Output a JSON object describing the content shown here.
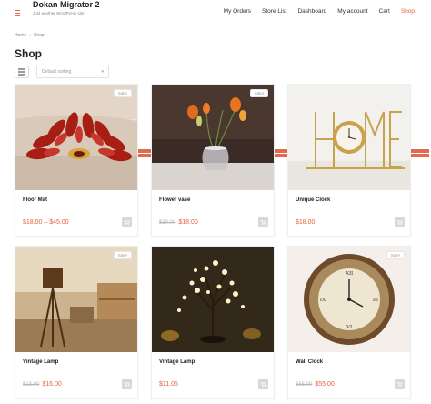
{
  "header": {
    "site_title": "Dokan Migrator 2",
    "tagline": "Just another WordPress site",
    "menu_icon": "hamburger-icon",
    "nav": [
      {
        "label": "My Orders",
        "active": false
      },
      {
        "label": "Store List",
        "active": false
      },
      {
        "label": "Dashboard",
        "active": false
      },
      {
        "label": "My account",
        "active": false
      },
      {
        "label": "Cart",
        "active": false
      },
      {
        "label": "Shop",
        "active": true
      }
    ]
  },
  "breadcrumb": {
    "home": "Home",
    "sep": "›",
    "current": "Shop"
  },
  "page": {
    "title": "Shop"
  },
  "toolbar": {
    "sort_value": "Default sorting",
    "view": "grid"
  },
  "colors": {
    "accent": "#e8613c",
    "muted": "#b5b5b5"
  },
  "products": [
    {
      "name": "Floor Mat",
      "sale_badge": "Sale!",
      "price_old": "",
      "price": "$18.00 – $45.00"
    },
    {
      "name": "Flower vase",
      "sale_badge": "Sale!",
      "price_old": "$30.00",
      "price": "$18.00"
    },
    {
      "name": "Unique Clock",
      "sale_badge": "",
      "price_old": "",
      "price": "$18.00"
    },
    {
      "name": "Vintage Lamp",
      "sale_badge": "Sale!",
      "price_old": "$18.00",
      "price": "$16.00"
    },
    {
      "name": "Vintage Lamp",
      "sale_badge": "",
      "price_old": "",
      "price": "$11.05"
    },
    {
      "name": "Wall Clock",
      "sale_badge": "Sale!",
      "price_old": "$65.00",
      "price": "$55.00"
    }
  ]
}
